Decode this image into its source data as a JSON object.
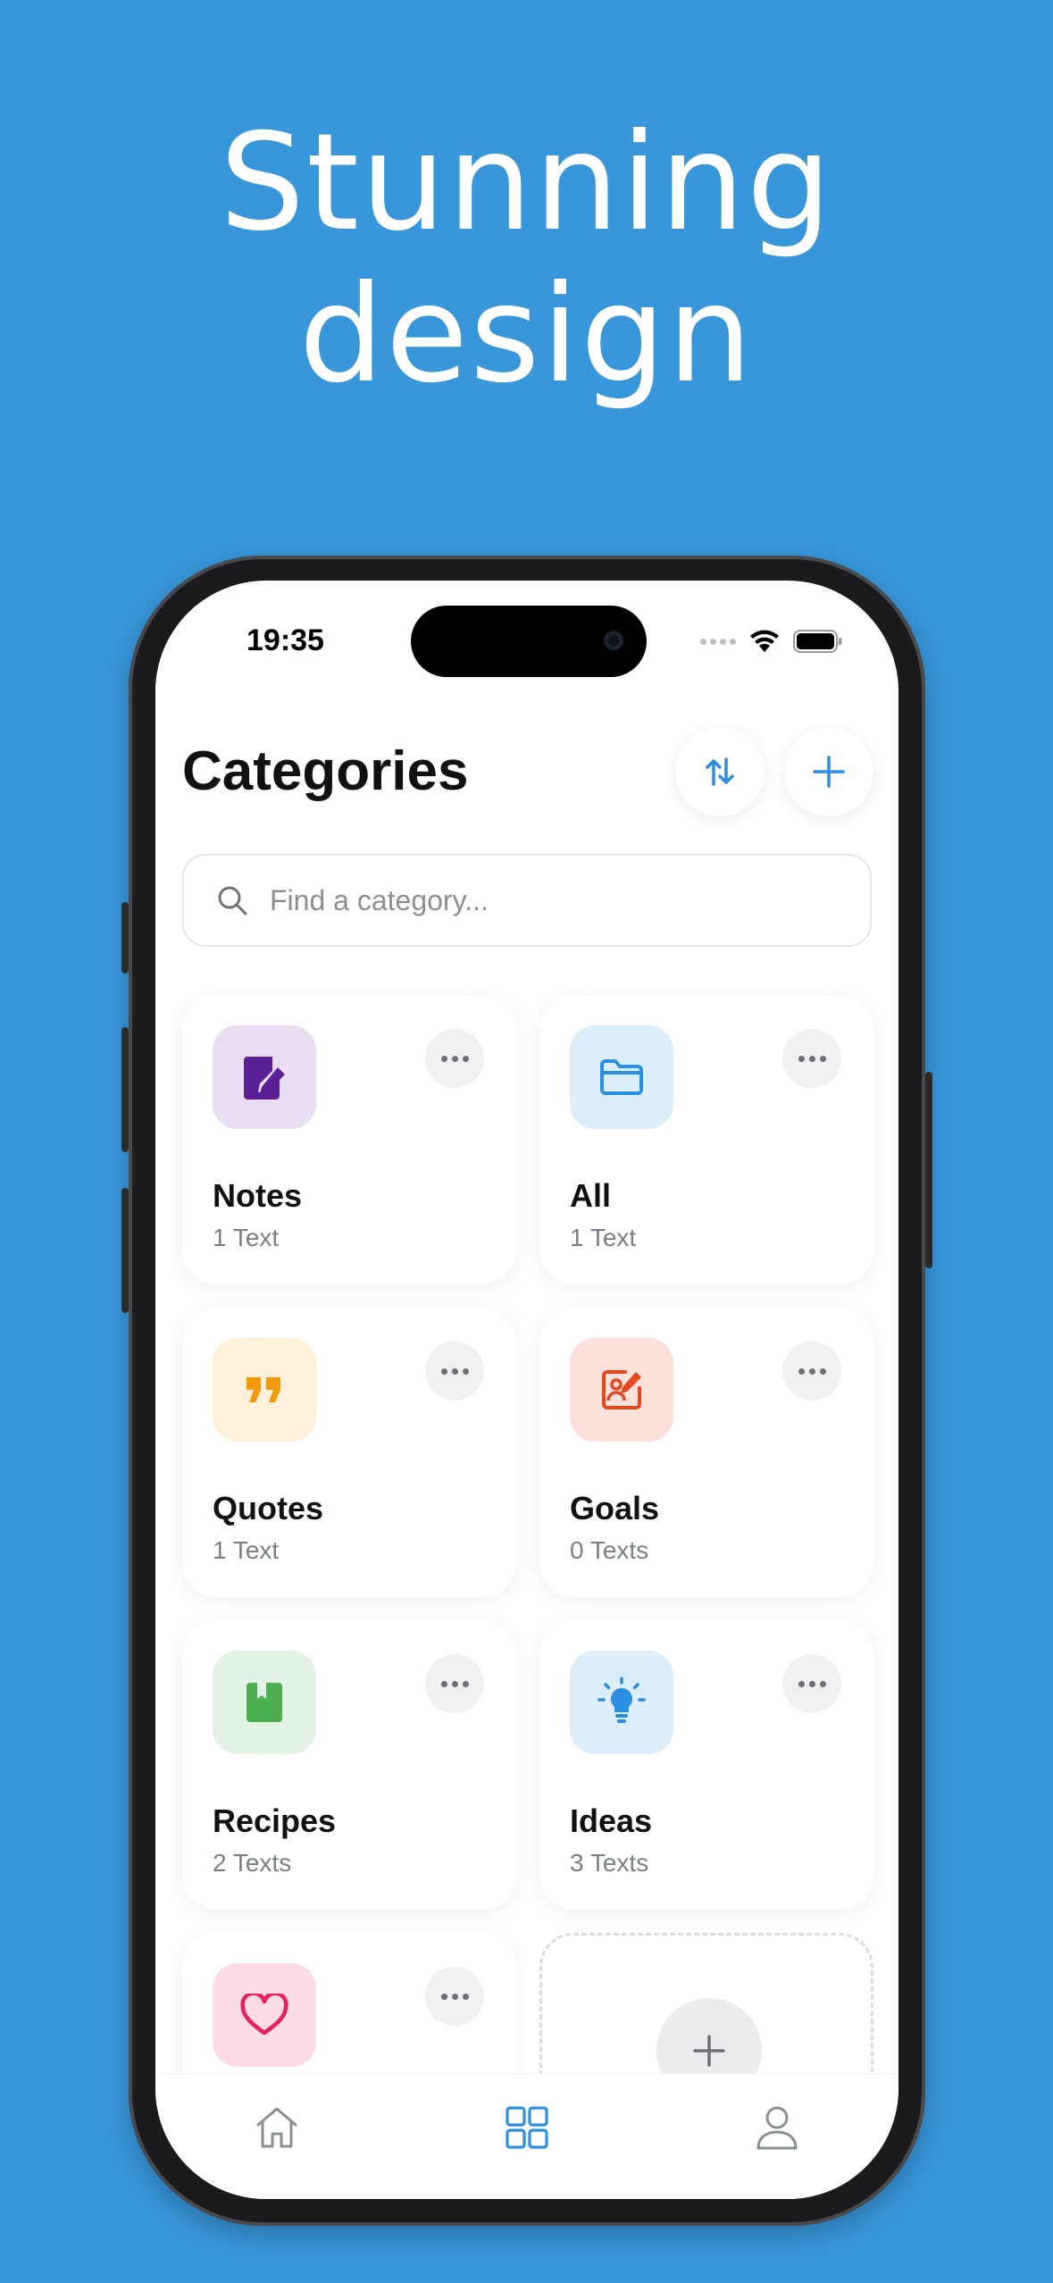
{
  "headline": {
    "line1": "Stunning",
    "line2": "design"
  },
  "status": {
    "time": "19:35"
  },
  "header": {
    "title": "Categories"
  },
  "search": {
    "placeholder": "Find a category..."
  },
  "categories": [
    {
      "name": "Notes",
      "count": "1 Text",
      "icon": "note-edit-icon",
      "color": "#5B1F96",
      "bg": "#E9DDF1"
    },
    {
      "name": "All",
      "count": "1 Text",
      "icon": "folder-icon",
      "color": "#2A8FE0",
      "bg": "#DDEEFB"
    },
    {
      "name": "Quotes",
      "count": "1 Text",
      "icon": "quote-icon",
      "color": "#F29A0F",
      "bg": "#FFF0DA"
    },
    {
      "name": "Goals",
      "count": "0 Texts",
      "icon": "goal-icon",
      "color": "#E5481F",
      "bg": "#FBE1DA"
    },
    {
      "name": "Recipes",
      "count": "2 Texts",
      "icon": "book-icon",
      "color": "#4CAF50",
      "bg": "#E3F3E4"
    },
    {
      "name": "Ideas",
      "count": "3 Texts",
      "icon": "lightbulb-icon",
      "color": "#2A8FE0",
      "bg": "#DDEEFB"
    },
    {
      "name": "",
      "count": "",
      "icon": "heart-icon",
      "color": "#E91E63",
      "bg": "#FCDDE7"
    }
  ],
  "colors": {
    "background": "#3897DB",
    "accent": "#2A8FE0"
  },
  "tabs": [
    {
      "icon": "home-icon",
      "active": false
    },
    {
      "icon": "grid-icon",
      "active": true
    },
    {
      "icon": "profile-icon",
      "active": false
    }
  ]
}
